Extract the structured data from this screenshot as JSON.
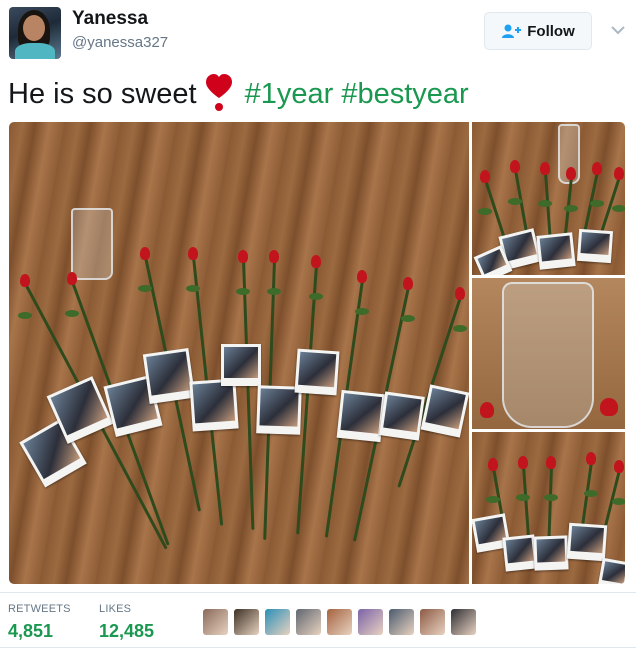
{
  "user": {
    "name": "Yanessa",
    "handle": "@yanessa327"
  },
  "follow_button": {
    "label": "Follow"
  },
  "tweet": {
    "text_before": "He is so sweet",
    "emoji": "red-heart-icon",
    "hashtags": [
      "#1year",
      "#bestyear"
    ]
  },
  "media": {
    "photo_count": 4
  },
  "stats": {
    "retweets_label": "RETWEETS",
    "retweets": "4,851",
    "likes_label": "LIKES",
    "likes": "12,485"
  },
  "likers": [
    {
      "color": "#8a6a5a"
    },
    {
      "color": "#3c3024"
    },
    {
      "color": "#2a8fb8"
    },
    {
      "color": "#5f6670"
    },
    {
      "color": "#a5623f"
    },
    {
      "color": "#7b62a8"
    },
    {
      "color": "#4a5a6e"
    },
    {
      "color": "#8c5a44"
    },
    {
      "color": "#2e2e34"
    }
  ],
  "colors": {
    "hashtag": "#1a9850",
    "heart": "#d0021b",
    "stat_value": "#1a9850",
    "muted": "#657786"
  }
}
